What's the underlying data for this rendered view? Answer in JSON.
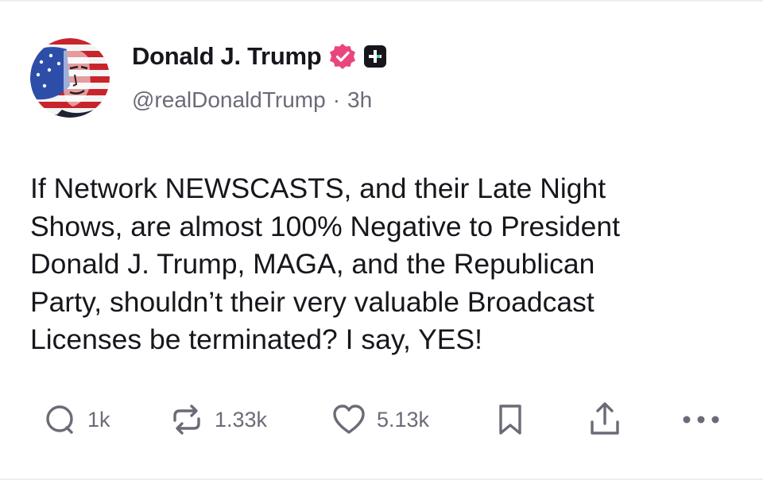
{
  "post": {
    "author": {
      "display_name": "Donald J. Trump",
      "handle": "@realDonaldTrump",
      "separator": "·",
      "time_ago": "3h",
      "avatar_icon": "flag-portrait-avatar",
      "verified_icon": "verified-badge-icon",
      "verified_color": "#e8467c",
      "plus_icon": "plus-badge-icon"
    },
    "text": "If Network NEWSCASTS, and their Late Night\nShows, are almost 100% Negative to President\nDonald J. Trump, MAGA, and the Republican\nParty, shouldn’t their very valuable Broadcast\nLicenses be terminated? I say, YES!",
    "actions": {
      "reply": {
        "icon": "reply-bubble-icon",
        "count": "1k"
      },
      "retruth": {
        "icon": "repost-arrows-icon",
        "count": "1.33k"
      },
      "like": {
        "icon": "heart-icon",
        "count": "5.13k"
      },
      "bookmark": {
        "icon": "bookmark-icon"
      },
      "share": {
        "icon": "share-upload-icon"
      },
      "more": {
        "icon": "more-dots-icon"
      }
    }
  },
  "colors": {
    "text": "#16161c",
    "muted": "#6b6b78",
    "verified": "#e8467c",
    "divider": "#eceef2"
  }
}
